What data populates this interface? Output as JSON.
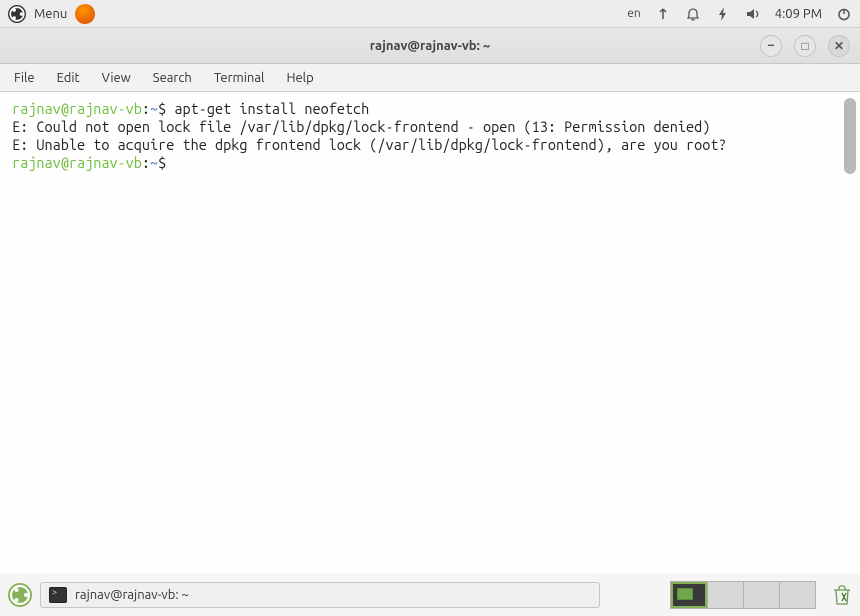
{
  "top_panel": {
    "menu_label": "Menu",
    "lang": "en",
    "clock": "4:09 PM"
  },
  "window": {
    "title": "rajnav@rajnav-vb: ~",
    "min_label": "–",
    "max_label": "□",
    "close_label": "✕"
  },
  "menubar": {
    "file": "File",
    "edit": "Edit",
    "view": "View",
    "search": "Search",
    "terminal": "Terminal",
    "help": "Help"
  },
  "terminal": {
    "prompt_user": "rajnav@rajnav-vb",
    "prompt_sep": ":",
    "prompt_path": "~",
    "prompt_dollar": "$",
    "cmd1": " apt-get install neofetch",
    "line2": "E: Could not open lock file /var/lib/dpkg/lock-frontend - open (13: Permission denied)",
    "line3": "E: Unable to acquire the dpkg frontend lock (/var/lib/dpkg/lock-frontend), are you root?",
    "cmd2": " "
  },
  "taskbar": {
    "item_label": "rajnav@rajnav-vb: ~"
  }
}
